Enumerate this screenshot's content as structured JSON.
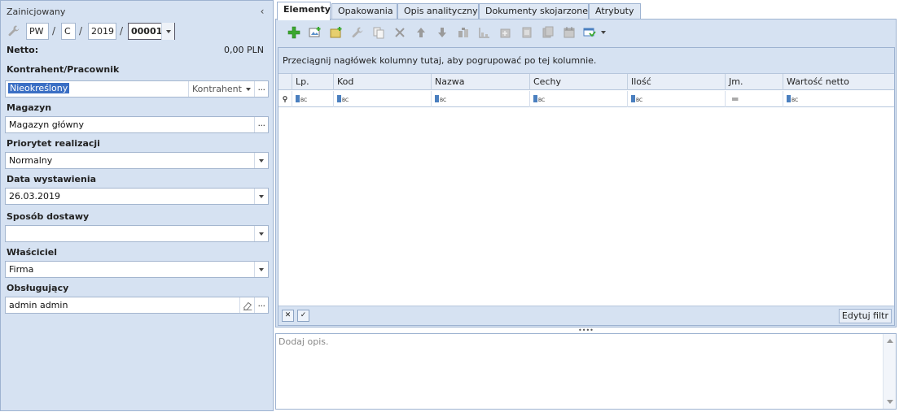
{
  "left": {
    "status": "Zainicjowany",
    "doc_number": {
      "prefix": "PW",
      "series": "C",
      "year": "2019",
      "number": "00001",
      "separator": "/"
    },
    "netto_label": "Netto:",
    "netto_value": "0,00 PLN",
    "contractor": {
      "label": "Kontrahent/Pracownik",
      "value": "Nieokreślony",
      "type": "Kontrahent"
    },
    "warehouse": {
      "label": "Magazyn",
      "value": "Magazyn główny"
    },
    "priority": {
      "label": "Priorytet realizacji",
      "value": "Normalny"
    },
    "issue_date": {
      "label": "Data wystawienia",
      "value": "26.03.2019"
    },
    "delivery": {
      "label": "Sposób dostawy",
      "value": ""
    },
    "owner": {
      "label": "Właściciel",
      "value": "Firma"
    },
    "handler": {
      "label": "Obsługujący",
      "value": "admin admin"
    }
  },
  "tabs": [
    {
      "label": "Elementy",
      "active": true
    },
    {
      "label": "Opakowania"
    },
    {
      "label": "Opis analityczny"
    },
    {
      "label": "Dokumenty skojarzone"
    },
    {
      "label": "Atrybuty"
    }
  ],
  "grid": {
    "group_hint": "Przeciągnij nagłówek kolumny tutaj, aby pogrupować po tej kolumnie.",
    "columns": [
      "Lp.",
      "Kod",
      "Nazwa",
      "Cechy",
      "Ilość",
      "Jm.",
      "Wartość netto"
    ],
    "edit_filter": "Edytuj filtr"
  },
  "description": {
    "placeholder": "Dodaj opis."
  },
  "colors": {
    "panel": "#d6e2f2",
    "border": "#9eb3d1",
    "accent_green": "#3aa82e",
    "selection": "#3b6fc4"
  }
}
